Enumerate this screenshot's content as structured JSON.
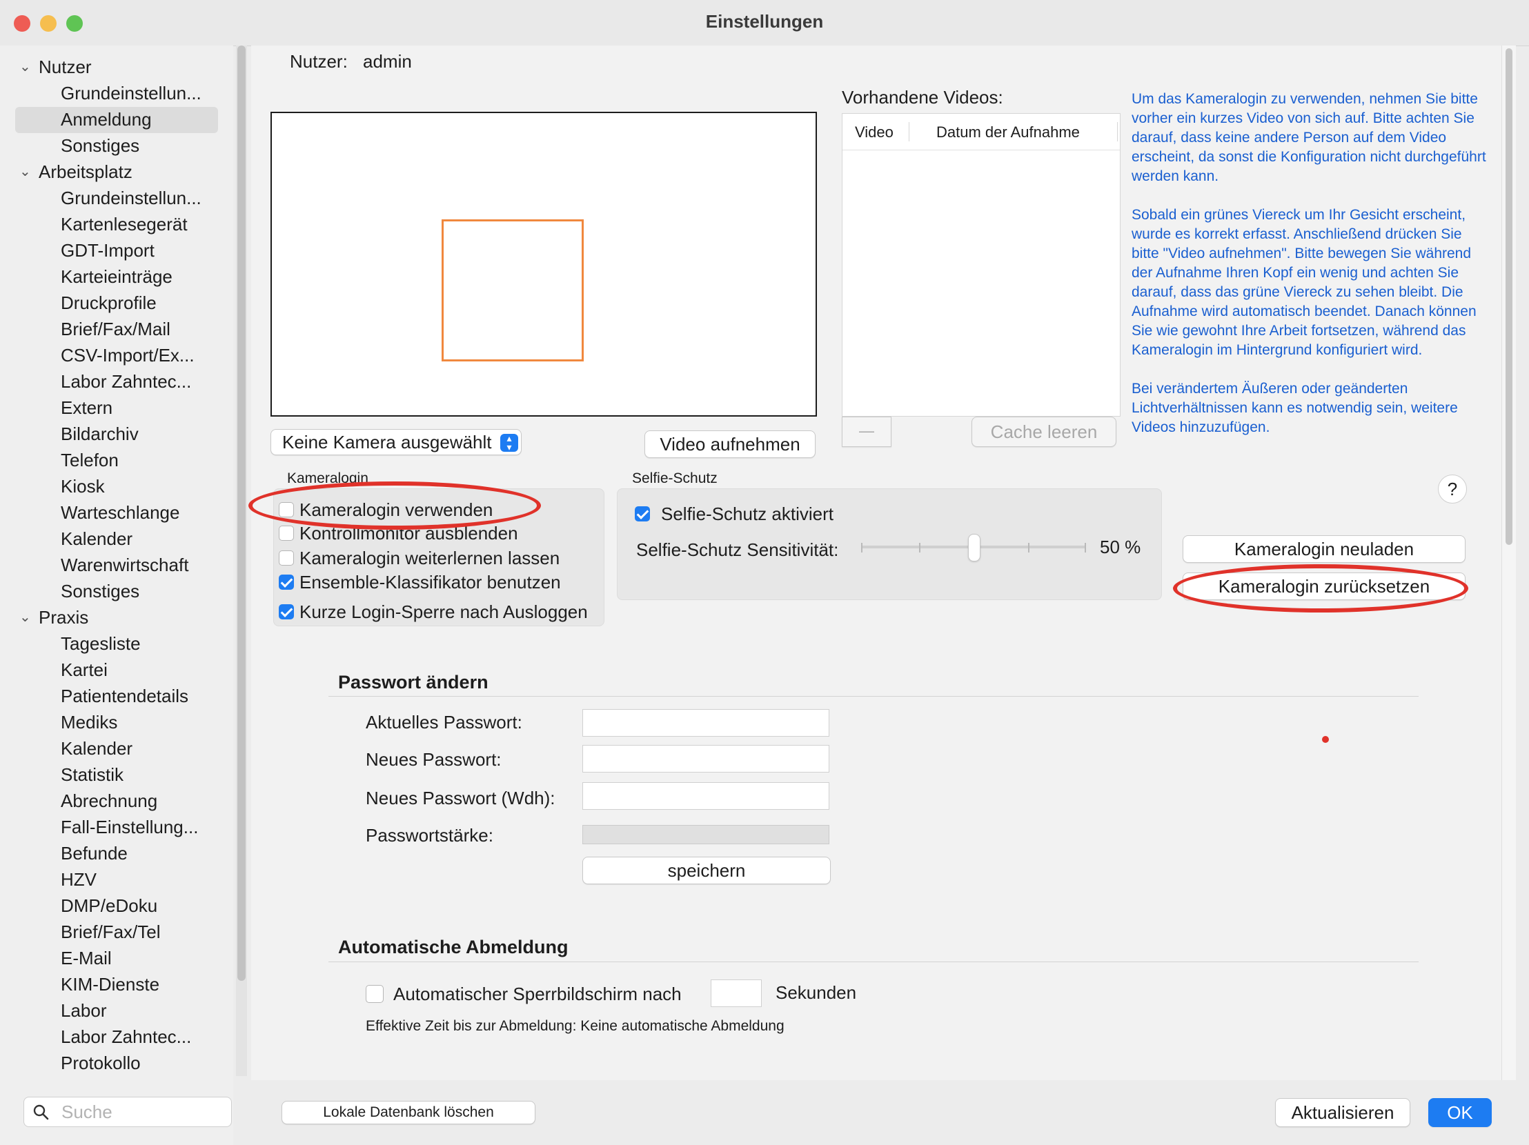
{
  "window": {
    "title": "Einstellungen"
  },
  "colors": {
    "accent": "#1d7cf2",
    "info_text": "#1a5fd0",
    "annotation_red": "#e0322a",
    "face_box": "#f0883e"
  },
  "sidebar": {
    "sections": [
      {
        "label": "Nutzer",
        "items": [
          "Grundeinstellun...",
          "Anmeldung",
          "Sonstiges"
        ]
      },
      {
        "label": "Arbeitsplatz",
        "items": [
          "Grundeinstellun...",
          "Kartenlesegerät",
          "GDT-Import",
          "Karteieinträge",
          "Druckprofile",
          "Brief/Fax/Mail",
          "CSV-Import/Ex...",
          "Labor Zahntec...",
          "Extern",
          "Bildarchiv",
          "Telefon",
          "Kiosk",
          "Warteschlange",
          "Kalender",
          "Warenwirtschaft",
          "Sonstiges"
        ]
      },
      {
        "label": "Praxis",
        "items": [
          "Tagesliste",
          "Kartei",
          "Patientendetails",
          "Mediks",
          "Kalender",
          "Statistik",
          "Abrechnung",
          "Fall-Einstellung...",
          "Befunde",
          "HZV",
          "DMP/eDoku",
          "Brief/Fax/Tel",
          "E-Mail",
          "KIM-Dienste",
          "Labor",
          "Labor Zahntec...",
          "Protokollo"
        ]
      }
    ],
    "selected": "Anmeldung",
    "search_placeholder": "Suche"
  },
  "main": {
    "user_label": "Nutzer:",
    "user_value": "admin",
    "camera_select": "Keine Kamera ausgewählt",
    "record_button": "Video aufnehmen",
    "videos_title": "Vorhandene Videos:",
    "videos_columns": [
      "Video",
      "Datum der Aufnahme"
    ],
    "remove_button": "—",
    "clear_cache_button": "Cache leeren",
    "info_paragraphs": [
      "Um das Kameralogin zu verwenden, nehmen Sie bitte vorher ein kurzes Video von sich auf. Bitte achten Sie darauf, dass keine andere Person auf dem Video erscheint, da sonst die Konfiguration nicht durchgeführt werden kann.",
      "Sobald ein grünes Viereck um Ihr Gesicht erscheint, wurde es korrekt erfasst. Anschließend drücken Sie bitte \"Video aufnehmen\". Bitte bewegen Sie während der Aufnahme Ihren Kopf ein wenig und achten Sie darauf, dass das grüne Viereck zu sehen bleibt. Die Aufnahme wird automatisch beendet. Danach können Sie wie gewohnt Ihre Arbeit fortsetzen, während das Kameralogin im Hintergrund konfiguriert wird.",
      "Bei verändertem Äußeren oder geänderten Lichtverhältnissen kann es notwendig sein, weitere Videos hinzuzufügen."
    ],
    "help_button": "?",
    "kameralogin": {
      "title": "Kameralogin",
      "options": [
        {
          "label": "Kameralogin verwenden",
          "checked": false
        },
        {
          "label": "Kontrollmonitor ausblenden",
          "checked": false
        },
        {
          "label": "Kameralogin weiterlernen lassen",
          "checked": false
        },
        {
          "label": "Ensemble-Klassifikator benutzen",
          "checked": true
        },
        {
          "label": "Kurze Login-Sperre nach Ausloggen",
          "checked": true
        }
      ]
    },
    "selfie": {
      "title": "Selfie-Schutz",
      "enabled_label": "Selfie-Schutz aktiviert",
      "enabled": true,
      "sensitivity_label": "Selfie-Schutz Sensitivität:",
      "sensitivity_value": "50 %",
      "sensitivity_fraction": 0.5
    },
    "reload_button": "Kameralogin neuladen",
    "reset_button": "Kameralogin zurücksetzen",
    "password": {
      "title": "Passwort ändern",
      "current_label": "Aktuelles Passwort:",
      "new_label": "Neues Passwort:",
      "repeat_label": "Neues Passwort (Wdh):",
      "strength_label": "Passwortstärke:",
      "save_button": "speichern"
    },
    "auto_logout": {
      "title": "Automatische Abmeldung",
      "checkbox_label": "Automatischer Sperrbildschirm nach",
      "checked": false,
      "seconds_value": "",
      "unit": "Sekunden",
      "effective": "Effektive Zeit bis zur Abmeldung: Keine automatische Abmeldung"
    }
  },
  "footer": {
    "delete_db_button": "Lokale Datenbank löschen",
    "refresh_button": "Aktualisieren",
    "ok_button": "OK"
  }
}
